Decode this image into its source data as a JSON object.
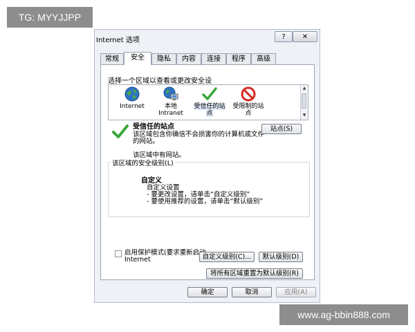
{
  "watermarks": {
    "top": "TG: MYYJJPP",
    "bottom": "www.ag-bbin888.com"
  },
  "dialog": {
    "title": "Internet 选项",
    "help_label": "?",
    "close_label": "✕"
  },
  "tabs": [
    {
      "label": "常规"
    },
    {
      "label": "安全"
    },
    {
      "label": "隐私"
    },
    {
      "label": "内容"
    },
    {
      "label": "连接"
    },
    {
      "label": "程序"
    },
    {
      "label": "高级"
    }
  ],
  "active_tab": "安全",
  "security": {
    "zone_prompt": "选择一个区域以查看或更改安全设",
    "zones": [
      {
        "label": "Internet",
        "icon": "globe-icon"
      },
      {
        "label": "本地\nIntranet",
        "icon": "local-intranet-icon"
      },
      {
        "label": "受信任的站\n点",
        "icon": "trusted-check-icon"
      },
      {
        "label": "受限制的站\n点",
        "icon": "restricted-icon"
      }
    ],
    "selected_zone": "受信任的站点",
    "zone_title": "受信任的站点",
    "zone_description": "该区域包含你确信不会损害你的计算机或文件的网站。",
    "zone_has_sites": "该区域中有网站。",
    "sites_button": "站点(S)",
    "level_legend": "该区域的安全级别(L)",
    "level_name": "自定义",
    "level_lines": [
      "自定义设置",
      "- 要更改设置，请单击“自定义级别”",
      "- 要使用推荐的设置，请单击“默认级别”"
    ],
    "protected_mode_label": "启用保护模式(要求重新启动 Internet",
    "protected_mode_checked": false,
    "custom_level_button": "自定义级别(C)...",
    "default_level_button": "默认级别(D)",
    "reset_all_button": "将所有区域重置为默认级别(R)"
  },
  "footer": {
    "ok": "确定",
    "cancel": "取消",
    "apply": "应用(A)"
  },
  "colors": {
    "dialog_bg": "#eef1f6",
    "check_green": "#3aa63a",
    "restricted_red": "#d42a20",
    "globe_blue": "#2d74c4"
  }
}
